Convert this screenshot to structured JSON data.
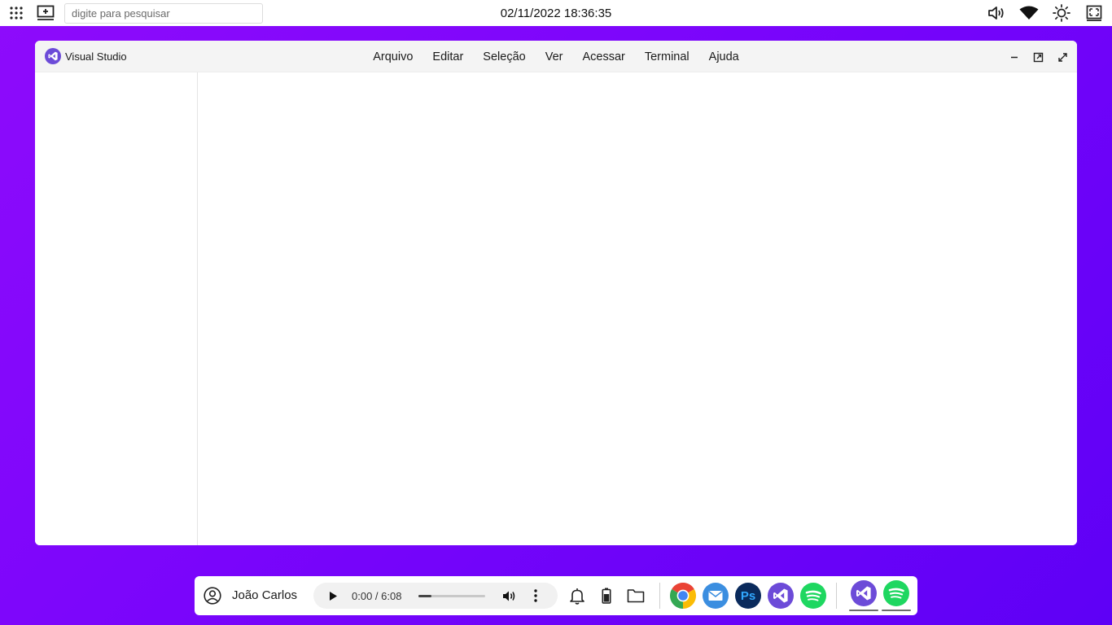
{
  "topbar": {
    "search_placeholder": "digite para pesquisar",
    "datetime": "02/11/2022 18:36:35",
    "icons": [
      "apps-grid-icon",
      "desktop-icon",
      "volume-icon",
      "wifi-icon",
      "brightness-icon",
      "screen-icon"
    ]
  },
  "window": {
    "app_title": "Visual Studio",
    "menu": [
      {
        "label": "Arquivo"
      },
      {
        "label": "Editar"
      },
      {
        "label": "Seleção"
      },
      {
        "label": "Ver"
      },
      {
        "label": "Acessar"
      },
      {
        "label": "Terminal"
      },
      {
        "label": "Ajuda"
      }
    ],
    "controls": [
      "minimize-icon",
      "restore-icon",
      "maximize-icon"
    ]
  },
  "dock": {
    "user_name": "João Carlos",
    "player": {
      "time": "0:00 / 6:08",
      "progress": 0.2
    },
    "apps": [
      {
        "name": "chrome",
        "label": ""
      },
      {
        "name": "mail",
        "label": ""
      },
      {
        "name": "photoshop",
        "label": "Ps"
      },
      {
        "name": "visual-studio",
        "label": ""
      },
      {
        "name": "spotify",
        "label": ""
      }
    ],
    "running": [
      "visual-studio",
      "spotify"
    ]
  },
  "colors": {
    "background_start": "#8e0bfb",
    "background_end": "#5e00f6",
    "vs_purple": "#6c4bd8",
    "spotify_green": "#1ed760",
    "photoshop_navy": "#0a2a5c",
    "mail_blue": "#3b8ee0"
  }
}
